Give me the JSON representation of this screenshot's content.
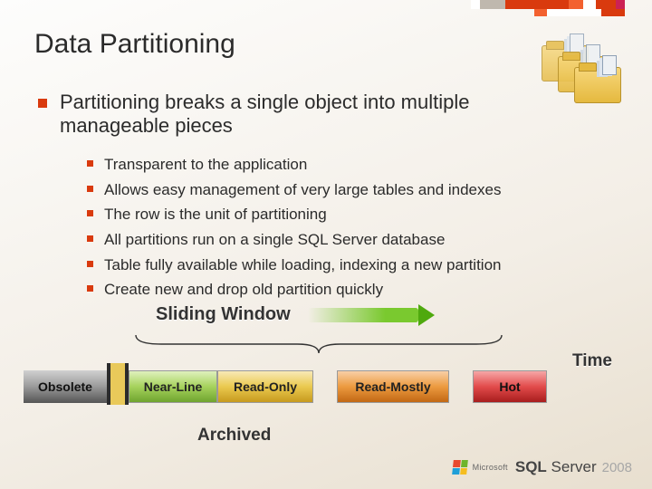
{
  "title": "Data Partitioning",
  "main_bullet": "Partitioning breaks a single object into multiple manageable pieces",
  "sub_bullets": [
    "Transparent to the application",
    "Allows easy management of very large tables and indexes",
    "The row is the unit of partitioning",
    "All partitions run on a single SQL Server database",
    "Table fully available while loading, indexing a new partition",
    "Create new and drop old partition quickly"
  ],
  "sliding_window_label": "Sliding Window",
  "time_label": "Time",
  "timeline": {
    "obsolete": "Obsolete",
    "near_line": "Near-Line",
    "read_only": "Read-Only",
    "read_mostly": "Read-Mostly",
    "hot": "Hot"
  },
  "archived_label": "Archived",
  "footer": {
    "company": "Microsoft",
    "product_a": "SQL",
    "product_b": "Server",
    "year": "2008"
  }
}
